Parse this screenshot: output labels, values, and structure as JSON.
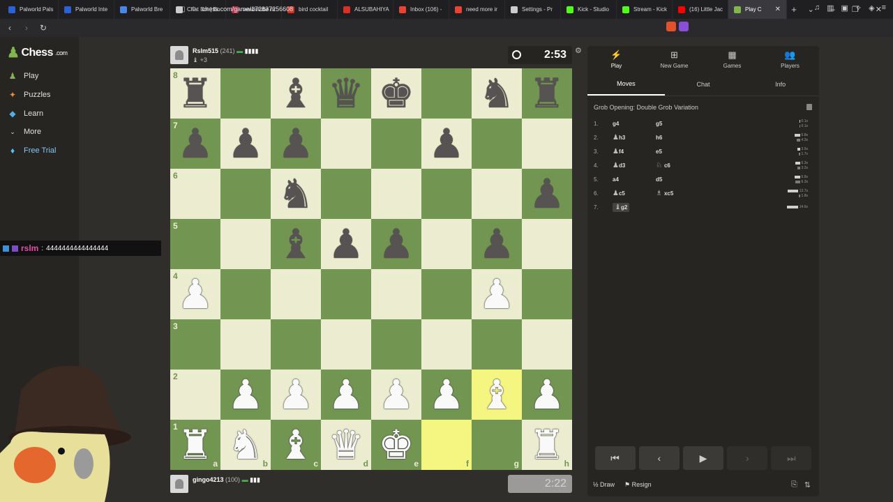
{
  "browser": {
    "tabs": [
      {
        "label": "Palworld Pals",
        "color": "#2b62d6"
      },
      {
        "label": "Palworld Inte",
        "color": "#2b62d6"
      },
      {
        "label": "Palworld Bre",
        "color": "#4a86e8"
      },
      {
        "label": "Chat Bot | Bo",
        "color": "#cccccc"
      },
      {
        "label": "veadotube m",
        "color": "#b5334a"
      },
      {
        "label": "bird cocktail",
        "color": "#d93025"
      },
      {
        "label": "ALSUBAHIYA",
        "color": "#d93025"
      },
      {
        "label": "Inbox (106) -",
        "color": "#ea4335"
      },
      {
        "label": "need more ir",
        "color": "#ea4335"
      },
      {
        "label": "Settings - Pr",
        "color": "#cccccc"
      },
      {
        "label": "Kick - Studio",
        "color": "#53fc18"
      },
      {
        "label": "Stream - Kick",
        "color": "#53fc18"
      },
      {
        "label": "(16) Little Jac",
        "color": "#ff0000"
      },
      {
        "label": "Play C",
        "color": "#81b64c"
      }
    ],
    "url": "chess.com/game/172837256608"
  },
  "sidebar": {
    "brand": "Chess",
    "brand_suffix": ".com",
    "items": [
      {
        "label": "Play",
        "icon": "play-pawn-icon"
      },
      {
        "label": "Puzzles",
        "icon": "puzzle-icon"
      },
      {
        "label": "Learn",
        "icon": "learn-icon"
      },
      {
        "label": "More",
        "icon": "chevron-down-icon"
      },
      {
        "label": "Free Trial",
        "icon": "diamond-icon"
      }
    ]
  },
  "overlay_chat": {
    "user": "rslm",
    "sep": " : ",
    "message": "4444444444444444"
  },
  "top_player": {
    "name": "Rslm515",
    "rating": "(241)",
    "captured": "+3",
    "clock": "2:53"
  },
  "bottom_player": {
    "name": "gingo4213",
    "rating": "(100)",
    "clock": "2:22"
  },
  "board": {
    "ranks": [
      "8",
      "7",
      "6",
      "5",
      "4",
      "3",
      "2",
      "1"
    ],
    "files": [
      "a",
      "b",
      "c",
      "d",
      "e",
      "f",
      "g",
      "h"
    ],
    "rows": [
      [
        "bR",
        "",
        "bB",
        "bQ",
        "bK",
        "",
        "bN",
        "bR"
      ],
      [
        "bP",
        "bP",
        "bP",
        "",
        "",
        "bP",
        "",
        ""
      ],
      [
        "",
        "",
        "bN",
        "",
        "",
        "",
        "",
        "bP"
      ],
      [
        "",
        "",
        "bB",
        "bP",
        "bP",
        "",
        "bP",
        ""
      ],
      [
        "wP",
        "",
        "",
        "",
        "",
        "",
        "wP",
        ""
      ],
      [
        "",
        "",
        "",
        "",
        "",
        "",
        "",
        ""
      ],
      [
        "",
        "wP",
        "wP",
        "wP",
        "wP",
        "wP",
        "wB",
        "wP"
      ],
      [
        "wR",
        "wN",
        "wB",
        "wQ",
        "wK",
        "",
        "",
        "wR"
      ]
    ],
    "highlight": [
      "f1",
      "g2"
    ]
  },
  "panel": {
    "tabs": [
      {
        "label": "Play",
        "icon": "bolt-icon"
      },
      {
        "label": "New Game",
        "icon": "plus-square-icon"
      },
      {
        "label": "Games",
        "icon": "board-icon"
      },
      {
        "label": "Players",
        "icon": "players-icon"
      }
    ],
    "subtabs": [
      "Moves",
      "Chat",
      "Info"
    ],
    "opening": "Grob Opening: Double Grob Variation",
    "moves": [
      {
        "n": "1.",
        "w": "g4",
        "wfig": "",
        "b": "g5",
        "bfig": "",
        "tw": "0.1s",
        "tb": "0.1s",
        "bw": 1,
        "bb": 1
      },
      {
        "n": "2.",
        "w": "h3",
        "wfig": "♟",
        "b": "h6",
        "bfig": "",
        "tw": "6.8s",
        "tb": "4.3s",
        "bw": 8,
        "bb": 5
      },
      {
        "n": "3.",
        "w": "f4",
        "wfig": "♟",
        "b": "e5",
        "bfig": "",
        "tw": "3.5s",
        "tb": "1.7s",
        "bw": 4,
        "bb": 2
      },
      {
        "n": "4.",
        "w": "d3",
        "wfig": "♟",
        "b": "c6",
        "bfig": "♘",
        "tw": "6.3s",
        "tb": "3.2s",
        "bw": 7,
        "bb": 4
      },
      {
        "n": "5.",
        "w": "a4",
        "wfig": "",
        "b": "d5",
        "bfig": "",
        "tw": "6.8s",
        "tb": "6.3s",
        "bw": 8,
        "bb": 7
      },
      {
        "n": "6.",
        "w": "c5",
        "wfig": "♟",
        "b": "xc5",
        "bfig": "♗",
        "tw": "13.7s",
        "tb": "1.8s",
        "bw": 15,
        "bb": 2
      },
      {
        "n": "7.",
        "w": "g2",
        "wfig": "♝",
        "b": "",
        "bfig": "",
        "tw": "14.6s",
        "tb": "",
        "bw": 16,
        "bb": 0
      }
    ],
    "draw_label": "Draw",
    "resign_label": "Resign",
    "draw_prefix": "½"
  }
}
